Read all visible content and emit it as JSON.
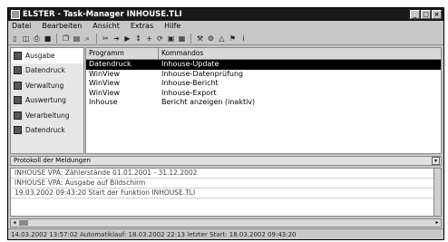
{
  "window": {
    "title": "ELSTER - Task-Manager INHOUSE.TLI"
  },
  "menu": [
    "Datei",
    "Bearbeiten",
    "Ansicht",
    "Extras",
    "Hilfe"
  ],
  "toolbar_icons": [
    "new-icon",
    "open-icon",
    "print-icon",
    "save-icon",
    "copy-icon",
    "paste-icon",
    "find-icon",
    "cut-icon",
    "arrow-icon",
    "run-icon",
    "stop-icon",
    "up-icon",
    "add-icon",
    "refresh-icon",
    "window-icon",
    "layout-icon",
    "tools-icon",
    "settings-icon",
    "bookmark-icon",
    "info-icon"
  ],
  "sidebar": [
    {
      "label": "Ausgabe",
      "icon": "output-icon"
    },
    {
      "label": "Datendruck",
      "icon": "print-data-icon"
    },
    {
      "label": "Verwaltung",
      "icon": "admin-icon"
    },
    {
      "label": "Auswertung",
      "icon": "analysis-icon"
    },
    {
      "label": "Verarbeitung",
      "icon": "process-icon"
    },
    {
      "label": "Datendruck",
      "icon": "play-icon"
    }
  ],
  "grid": {
    "headers": [
      "Programm",
      "Kommandos"
    ],
    "rows": [
      {
        "program": "Datendruck",
        "command": "Inhouse-Update",
        "selected": true
      },
      {
        "program": "WinView",
        "command": "Inhouse-Datenprüfung"
      },
      {
        "program": "WinView",
        "command": "Inhouse-Bericht"
      },
      {
        "program": "WinView",
        "command": "Inhouse-Export"
      },
      {
        "program": "Inhouse",
        "command": "Bericht anzeigen (inaktiv)"
      }
    ]
  },
  "panel": {
    "title": "Protokoll der Meldungen"
  },
  "log": [
    "INHOUSE VPA: Zählerstände 01.01.2001 - 31.12.2002",
    "INHOUSE VPA: Ausgabe auf Bildschirm",
    "19.03.2002 09:43:20 Start der Funktion INHOUSE.TLI"
  ],
  "status": "14.03.2002 13:57:02   Automatiklauf: 18.03.2002  22:13   letzter Start: 18.03.2002  09:43:20"
}
